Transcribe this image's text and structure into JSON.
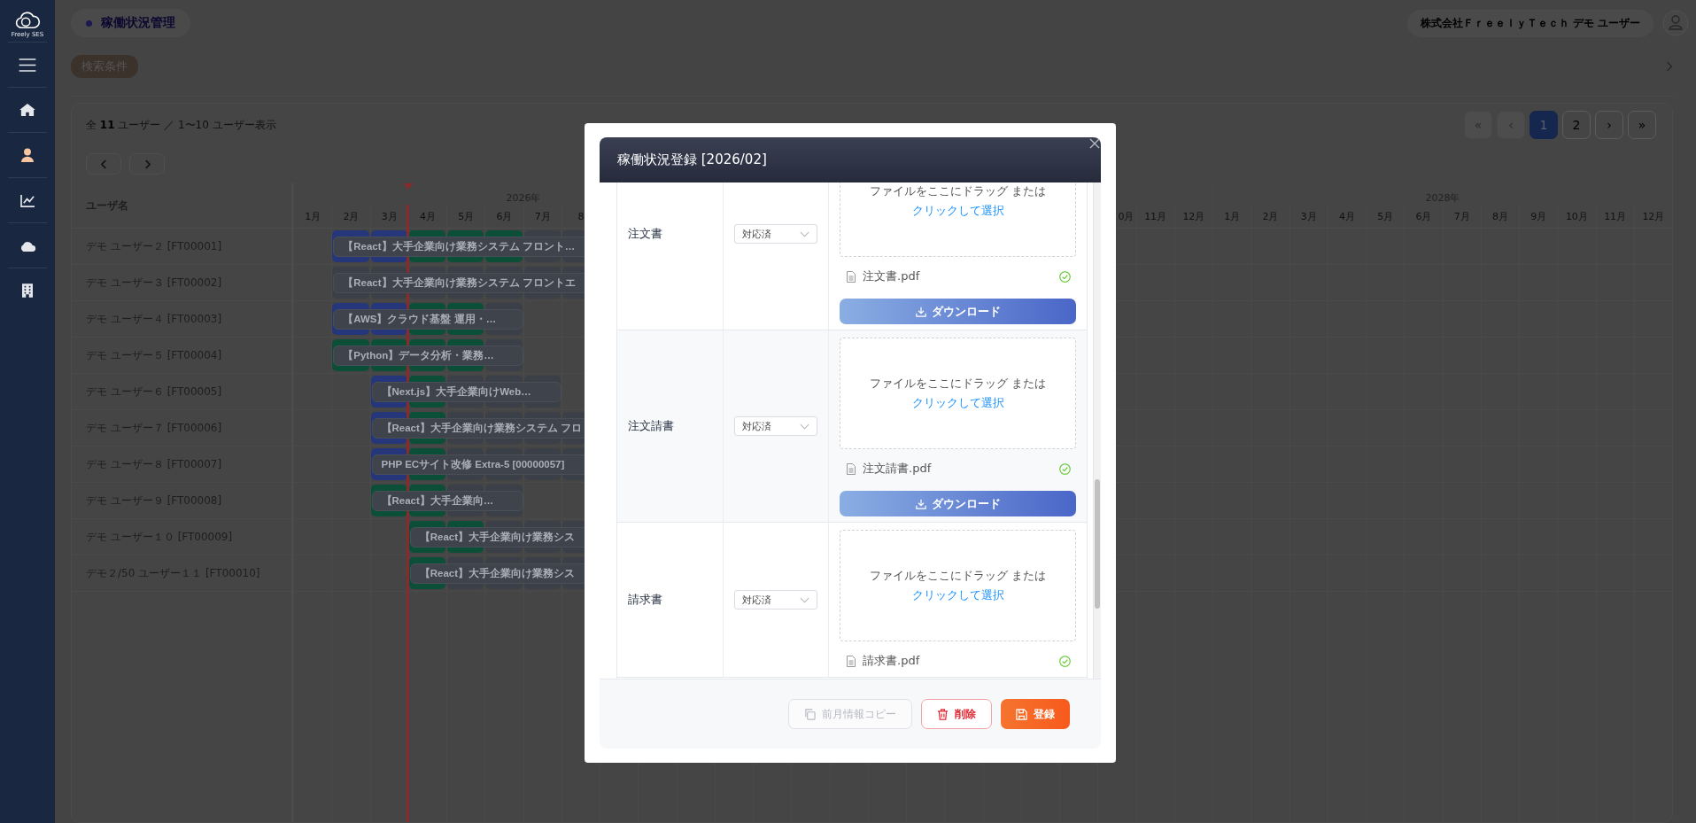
{
  "sidebar": {
    "logo_text": "Freely SES",
    "items": [
      {
        "kind": "menu",
        "selected": false
      },
      {
        "kind": "home",
        "selected": false
      },
      {
        "kind": "user",
        "selected": true
      },
      {
        "kind": "chart",
        "selected": false
      },
      {
        "kind": "cloud",
        "selected": false
      },
      {
        "kind": "building",
        "selected": false
      }
    ]
  },
  "header": {
    "page_title": "稼働状況管理",
    "account": "株式会社ＦｒｅｅｌｙＴｅｃｈ デモ ユーザー"
  },
  "search": {
    "label": "検索条件",
    "expanded": false
  },
  "summary": "全 **11** ユーザー ／ 1〜10 ユーザー表示",
  "pagination": [
    {
      "label": "«",
      "selected": false,
      "disabled": true
    },
    {
      "label": "‹",
      "selected": false,
      "disabled": true
    },
    {
      "label": "1",
      "selected": true,
      "disabled": false
    },
    {
      "label": "2",
      "selected": false,
      "disabled": false
    },
    {
      "label": "›",
      "selected": false,
      "disabled": false
    },
    {
      "label": "»",
      "selected": false,
      "disabled": false
    }
  ],
  "gantt": {
    "name_header": "ユーザ名",
    "years": [
      {
        "label": "2026年",
        "months": [
          "1月",
          "2月",
          "3月",
          "4月",
          "5月",
          "6月",
          "7月",
          "8"
        ]
      },
      {
        "months": [
          "0月",
          "11月",
          "12月"
        ]
      },
      {
        "label": "2028年",
        "months": [
          "1月",
          "2月",
          "3月",
          "4月",
          "5月",
          "6月",
          "7月",
          "8月",
          "9月",
          "10月",
          "11月",
          "12月"
        ]
      }
    ],
    "rows": [
      {
        "name": "デモ ユーザー２ [FT00001]",
        "bar": "【React】大手企業向け業務システム フロント…",
        "cells": [
          null,
          {
            "color": "#26367a"
          },
          {
            "color": "#26367a"
          },
          {
            "color": "#0b4f38"
          },
          {
            "color": "#0b4f38"
          },
          {
            "color": "#0b4f38"
          },
          {
            "color": "#3b4048"
          },
          {
            "color": "#3b4048"
          }
        ]
      },
      {
        "name": "デモ ユーザー３ [FT00002]",
        "bar": "【React】大手企業向け業務システム フロントエ",
        "cells": [
          null,
          {
            "color": "#3b4048"
          },
          {
            "color": "#3b4048"
          },
          {
            "color": "#3b4048"
          },
          {
            "color": "#3b4048"
          },
          {
            "color": "#3b4048"
          },
          {
            "color": "#3b4048"
          },
          {
            "color": "#3b4048"
          }
        ]
      },
      {
        "name": "デモ ユーザー４ [FT00003]",
        "bar": "【AWS】クラウド基盤 運用・…",
        "cells": [
          null,
          {
            "color": "#26367a"
          },
          {
            "color": "#26367a"
          },
          {
            "color": "#0b4f38"
          },
          {
            "color": "#0b4f38"
          },
          {
            "color": "#3b4048"
          },
          null,
          null
        ]
      },
      {
        "name": "デモ ユーザー５ [FT00004]",
        "bar": "【Python】データ分析・業務…",
        "cells": [
          null,
          {
            "color": "#0b4f38"
          },
          {
            "color": "#0b4f38"
          },
          {
            "color": "#0b4f38"
          },
          {
            "color": "#0b4f38"
          },
          {
            "color": "#3b4048"
          },
          null,
          null
        ]
      },
      {
        "name": "デモ ユーザー６ [FT00005]",
        "bar": "【Next.js】大手企業向けWeb…",
        "cells": [
          null,
          null,
          {
            "color": "#26367a"
          },
          {
            "color": "#0b4f38"
          },
          {
            "color": "#3b4048"
          },
          {
            "color": "#3b4048"
          },
          {
            "color": "#3b4048"
          },
          null
        ]
      },
      {
        "name": "デモ ユーザー７ [FT00006]",
        "bar": "【React】大手企業向け業務システム フロ",
        "cells": [
          null,
          null,
          {
            "color": "#26367a"
          },
          {
            "color": "#0b4f38"
          },
          {
            "color": "#3b4048"
          },
          {
            "color": "#3b4048"
          },
          {
            "color": "#3b4048"
          },
          {
            "color": "#3b4048"
          }
        ]
      },
      {
        "name": "デモ ユーザー８ [FT00007]",
        "bar": "PHP ECサイト改修 Extra-5 [00000057]",
        "cells": [
          null,
          null,
          {
            "color": "#26367a"
          },
          {
            "color": "#0b4f38"
          },
          {
            "color": "#3b4048"
          },
          {
            "color": "#3b4048"
          },
          {
            "color": "#3b4048"
          },
          {
            "color": "#3b4048"
          }
        ]
      },
      {
        "name": "デモ ユーザー９ [FT00008]",
        "bar": "【React】大手企業向…",
        "cells": [
          null,
          null,
          {
            "color": "#0b4f38"
          },
          {
            "color": "#0b4f38"
          },
          {
            "color": "#3b4048"
          },
          {
            "color": "#3b4048"
          },
          null,
          null
        ]
      },
      {
        "name": "デモ ユーザー１０ [FT00009]",
        "bar": "【React】大手企業向け業務シス",
        "cells": [
          null,
          null,
          null,
          {
            "color": "#0b4f38"
          },
          {
            "color": "#0b4f38"
          },
          {
            "color": "#3b4048"
          },
          {
            "color": "#3b4048"
          },
          {
            "color": "#3b4048"
          }
        ]
      },
      {
        "name": "デモ２/50 ユーザー１１ [FT00010]",
        "bar": "【React】大手企業向け業務シス",
        "cells": [
          null,
          null,
          null,
          {
            "color": "#0b4f38"
          },
          {
            "color": "#3b4048"
          },
          {
            "color": "#3b4048"
          },
          {
            "color": "#3b4048"
          },
          {
            "color": "#3b4048"
          }
        ]
      }
    ]
  },
  "modal": {
    "title": "稼働状況登録 [2026/02]",
    "rows": [
      {
        "label": "注文書",
        "status": "対応済",
        "drop_hint": "ファイルをここにドラッグ または",
        "drop_link": "クリックして選択",
        "file": {
          "name": "注文書.pdf",
          "uploaded": true
        },
        "download": "ダウンロード"
      },
      {
        "label": "注文請書",
        "status": "対応済",
        "drop_hint": "ファイルをここにドラッグ または",
        "drop_link": "クリックして選択",
        "file": {
          "name": "注文請書.pdf",
          "uploaded": true
        },
        "download": "ダウンロード"
      },
      {
        "label": "請求書",
        "status": "対応済",
        "drop_hint": "ファイルをここにドラッグ または",
        "drop_link": "クリックして選択",
        "file": {
          "name": "請求書.pdf",
          "uploaded": true
        }
      }
    ],
    "buttons": [
      {
        "kind": "copy",
        "label": "前月情報コピー",
        "disabled": true
      },
      {
        "kind": "delete",
        "label": "削除",
        "disabled": false
      },
      {
        "kind": "save",
        "label": "登録",
        "disabled": false
      }
    ]
  }
}
